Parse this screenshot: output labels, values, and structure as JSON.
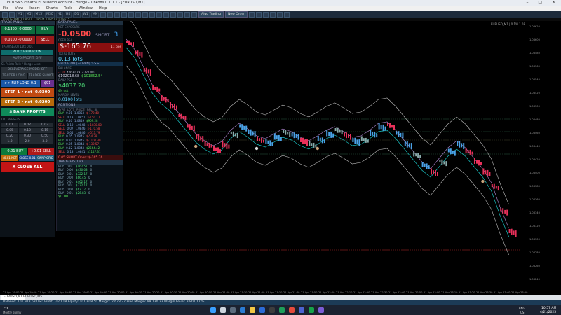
{
  "window": {
    "title": "ECN SMS (Sharp) ECN Demo Account - Hedge - Tinkoffs 0.1.1.1 - [EURUSD,M1]"
  },
  "menu": [
    "File",
    "View",
    "Insert",
    "Charts",
    "Tools",
    "Window",
    "Help"
  ],
  "toolbar": {
    "timeframes": [
      "M1",
      "M5",
      "M15",
      "M30",
      "H1",
      "H4",
      "D1",
      "W1",
      "MN"
    ],
    "algo_label": "Algo Trading",
    "new_order_label": "New Order"
  },
  "chart_header": "EURUSD,M1  1.08521 1.08524 1.08512 1.08515",
  "trade_panel": {
    "title": "TRADE PANEL",
    "buy_price": "0.1300",
    "buy_pnl": "-0.0000",
    "buy_label": "BUY",
    "sell_price": "0.0100",
    "sell_pnl": "-0.0000",
    "sell_label": "SELL",
    "account_label": "TP=0/SL=0 | Lots 0.01",
    "auto_hedge": "AUTO HEDGE: ON",
    "auto_profit": "AUTO PROFIT: OFF",
    "label_2": "SL Points Rule / Hedge Level",
    "delevenage": "DELEVERAGE MODE: OFF",
    "trader_long": "TRADER LONG",
    "trader_short": "TRADER SHORT",
    "flip_long": ">> FLIP LONG  0.1",
    "pnl_btn": "$91",
    "step1": "STEP-1 • net -0.0300",
    "step2": "STEP-2 • net -0.0200",
    "bank": "$  BANK PROFITS",
    "presets_label": "LOT PRESETS",
    "presets": [
      "0.01",
      "0.02",
      "0.03",
      "0.05",
      "0.10",
      "0.15",
      "0.20",
      "0.30",
      "0.50",
      "1.0",
      "2.0",
      "3.0"
    ],
    "buy_btn": "+0.01 BUY",
    "sell_btn": "+0.01 SELL",
    "sub_btns": [
      "+0.01 NET",
      "CLOSE 0.01",
      "SWAP GRID"
    ],
    "close_all": "X  CLOSE ALL"
  },
  "data_panel": {
    "title": "DATA PANEL",
    "net_exposure_label": "NET EXPOSURE",
    "net_exposure": "-0.0500",
    "side": "SHORT",
    "count": "3",
    "open_pnl_label": "OPEN P&L",
    "open_pnl": "$-165.76",
    "pos_label": "11 pos",
    "total_lots_label": "TOTAL LOTS",
    "total_lots": "0.13 lots",
    "hedge_label": "HEDGE ON [+OPEN] >>>",
    "balance_label": "BALANCE",
    "balance_a": "-170",
    "balance_vals": [
      "4763.079",
      "4722.082"
    ],
    "equity": "$102018.68",
    "equity2": "$101852.54",
    "day_label": "DAILY P&L",
    "day_pnl": "$4037.20",
    "day_pct": "4% ddt",
    "margin_label": "MARGIN LEVEL",
    "margin": "0.0100 lots",
    "positions_label": "POSITIONS",
    "positions_cols": [
      "TYPE",
      "LOTS",
      "PRICE",
      "P&L",
      "SL"
    ],
    "positions": [
      [
        "BUY",
        "0.01",
        "1.0853",
        "$-172.40",
        ""
      ],
      [
        "SELL",
        "0.13",
        "1.0851",
        "$-150.17",
        ""
      ],
      [
        "BUY",
        "0.10",
        "1.0849",
        "$909.28",
        ""
      ],
      [
        "SELL",
        "0.10",
        "1.0848",
        "$-1830.00",
        ""
      ],
      [
        "SELL",
        "0.07",
        "1.0846",
        "$-170.58",
        ""
      ],
      [
        "SELL",
        "0.05",
        "1.0846",
        "$-513.79",
        ""
      ],
      [
        "BUY",
        "0.05",
        "1.0845",
        "$-54.38",
        ""
      ],
      [
        "BUY",
        "0.10",
        "1.0845",
        "$-1100.30",
        ""
      ],
      [
        "BUY",
        "0.05",
        "1.0844",
        "$-132.57",
        ""
      ],
      [
        "BUY",
        "0.12",
        "1.0843",
        "$2564.42",
        ""
      ],
      [
        "SELL",
        "0.13",
        "1.0841",
        "$1147.31",
        ""
      ]
    ],
    "summary_line": "0.05 SHORT  Open: $-165.76",
    "history_label": "TRADE HISTORY",
    "history": [
      [
        "BUY",
        "0.01",
        "$462.51",
        "0"
      ],
      [
        "BUY",
        "0.00",
        "$430.08",
        "0"
      ],
      [
        "BUY",
        "0.01",
        "$322.17",
        "0"
      ],
      [
        "BUY",
        "0.00",
        "$66.45",
        "0"
      ],
      [
        "BUY",
        "0.01",
        "$462.17",
        "0"
      ],
      [
        "BUY",
        "0.01",
        "$322.17",
        "0"
      ],
      [
        "BUY",
        "0.00",
        "$62.17",
        "0"
      ],
      [
        "BUY",
        "0.01",
        "$26.83",
        "0"
      ]
    ],
    "history_total": "$0.00"
  },
  "chart": {
    "price_labels": [
      "1.08620",
      "1.08600",
      "1.08580",
      "1.08560",
      "1.08540",
      "1.08520",
      "1.08500",
      "1.08480",
      "1.08460",
      "1.08440",
      "1.08420",
      "1.08400",
      "1.08380",
      "1.08360",
      "1.08340",
      "1.08320",
      "1.08300",
      "1.08280",
      "1.08260",
      "1.08240"
    ],
    "time_labels": [
      "21 Apr 19:00",
      "21 Apr 19:10",
      "21 Apr 19:20",
      "21 Apr 19:30",
      "21 Apr 19:40",
      "21 Apr 19:50",
      "21 Apr 20:00",
      "21 Apr 20:10",
      "21 Apr 20:20",
      "21 Apr 20:30",
      "21 Apr 20:40",
      "21 Apr 20:50",
      "21 Apr 21:00",
      "21 Apr 21:10",
      "21 Apr 21:20",
      "21 Apr 21:30",
      "21 Apr 21:40",
      "21 Apr 21:50",
      "21 Apr 22:00",
      "21 Apr 22:10",
      "21 Apr 22:20",
      "21 Apr 22:30",
      "21 Apr 22:40",
      "21 Apr 22:50",
      "21 Apr 23:00",
      "21 Apr 23:10",
      "21 Apr 23:20",
      "21 Apr 23:30",
      "21 Apr 23:40",
      "21 Apr 23:50"
    ],
    "corner_label": "EURUSD_M1 | 0.1% 1.087"
  },
  "tabs": [
    "EURUSD,M1",
    "EURUSD,M5"
  ],
  "status": "Balance: 101 978.68 USD  Profit: -170.18  Equity: 101 808.50  Margin: 2 678.27  Free Margin: 99 130.23  Margin Level: 3 801.17 %",
  "taskbar": {
    "weather_temp": "7°C",
    "weather_desc": "Mostly sunny",
    "lang": "ENG",
    "lang2": "US",
    "time": "10:57 AM",
    "date": "4/21/2025"
  }
}
